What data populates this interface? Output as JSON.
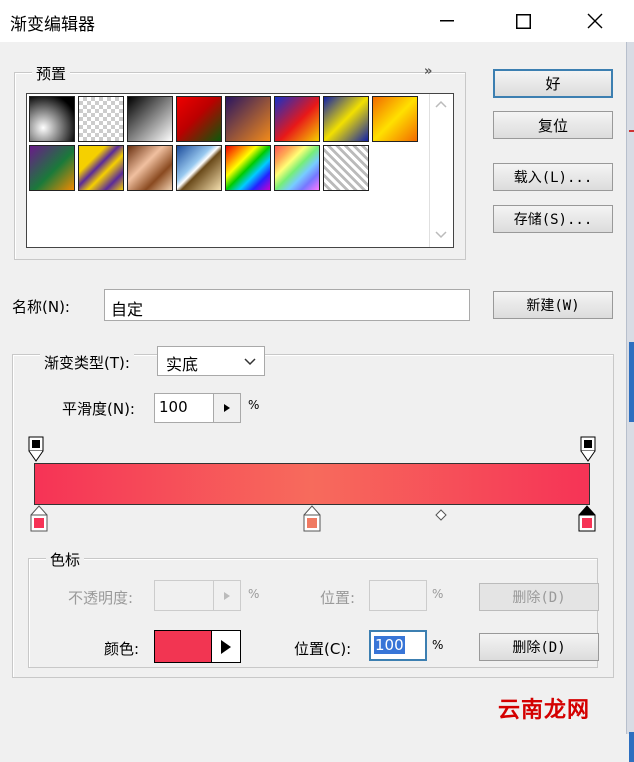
{
  "window": {
    "title": "渐变编辑器"
  },
  "presets": {
    "legend": "预置",
    "swatches": [
      {
        "name": "black-white-radial",
        "bg": "radial-gradient(circle at 30% 70%, #fff 0%, #000 80%)"
      },
      {
        "name": "black-transparent",
        "bg": "repeating-conic-gradient(#ccc 0 25%, #fff 0 50%) 0 0/8px 8px"
      },
      {
        "name": "black-white",
        "bg": "linear-gradient(135deg,#000,#fff)"
      },
      {
        "name": "red-green",
        "bg": "linear-gradient(135deg,#e00 0%,#b00 45%,#0a5a0a 100%)"
      },
      {
        "name": "violet-orange",
        "bg": "linear-gradient(135deg,#2a1660,#f28a1a)"
      },
      {
        "name": "blue-red-yellow",
        "bg": "linear-gradient(135deg,#1530c8 0%,#e81818 55%,#f5d000 100%)"
      },
      {
        "name": "blue-yellow-blue",
        "bg": "linear-gradient(135deg,#1020a8 0%,#f2e000 50%,#1020a8 100%)"
      },
      {
        "name": "orange-yellow-orange",
        "bg": "linear-gradient(135deg,#f26a00 0%,#ffe000 50%,#f26a00 100%)"
      },
      {
        "name": "violet-green-orange",
        "bg": "linear-gradient(135deg,#6a1a8a 0%,#1a7a3a 55%,#f28a00 100%)"
      },
      {
        "name": "yellow-violet-stripes",
        "bg": "linear-gradient(135deg,#f5d000 0%,#f5d000 30%,#5a2a9a 45%,#f5d000 60%,#5a2a9a 80%,#f5d000 100%)"
      },
      {
        "name": "copper",
        "bg": "linear-gradient(135deg,#6a3010 0%,#f0c0a0 40%,#8a4a20 70%,#f0d0b0 100%)"
      },
      {
        "name": "chrome",
        "bg": "linear-gradient(135deg,#1a4a9a 0%,#9acaf0 40%,#fff 48%,#6a4a1a 55%,#f5e0b0 100%)"
      },
      {
        "name": "spectrum",
        "bg": "linear-gradient(135deg,#e00 0%,#f80 20%,#ff0 35%,#0c0 50%,#0cf 65%,#22f 80%,#c0c 100%)"
      },
      {
        "name": "transparent-rainbow",
        "bg": "linear-gradient(135deg,#f55 0%,#fa5 20%,#ff7 35%,#7e7 50%,#7cf 65%,#77f 80%,#f7f 100%)"
      },
      {
        "name": "transparent-stripes",
        "bg": "repeating-linear-gradient(45deg,#fff 0 3px,#bbb 3px 6px)"
      }
    ]
  },
  "buttons": {
    "ok": "好",
    "reset": "复位",
    "load": "载入(L)...",
    "save": "存储(S)...",
    "new": "新建(W)"
  },
  "name_field": {
    "label": "名称(N):",
    "value": "自定"
  },
  "gradient_type": {
    "label": "渐变类型(T):",
    "value": "实底"
  },
  "smoothness": {
    "label": "平滑度(N):",
    "value": "100",
    "unit": "%"
  },
  "gradient_bar": {
    "colors": [
      "#f63356",
      "#f76b5c",
      "#f63356"
    ],
    "stops": [
      0,
      50,
      100
    ]
  },
  "color_stops": {
    "legend": "色标",
    "opacity_label": "不透明度:",
    "opacity_unit": "%",
    "opacity_position_label": "位置:",
    "opacity_position_unit": "%",
    "opacity_delete": "删除(D)",
    "color_label": "颜色:",
    "color_value": "#f23552",
    "position_label": "位置(C):",
    "position_value": "100",
    "position_unit": "%",
    "delete": "删除(D)"
  },
  "watermark": {
    "text": "云南龙网"
  }
}
